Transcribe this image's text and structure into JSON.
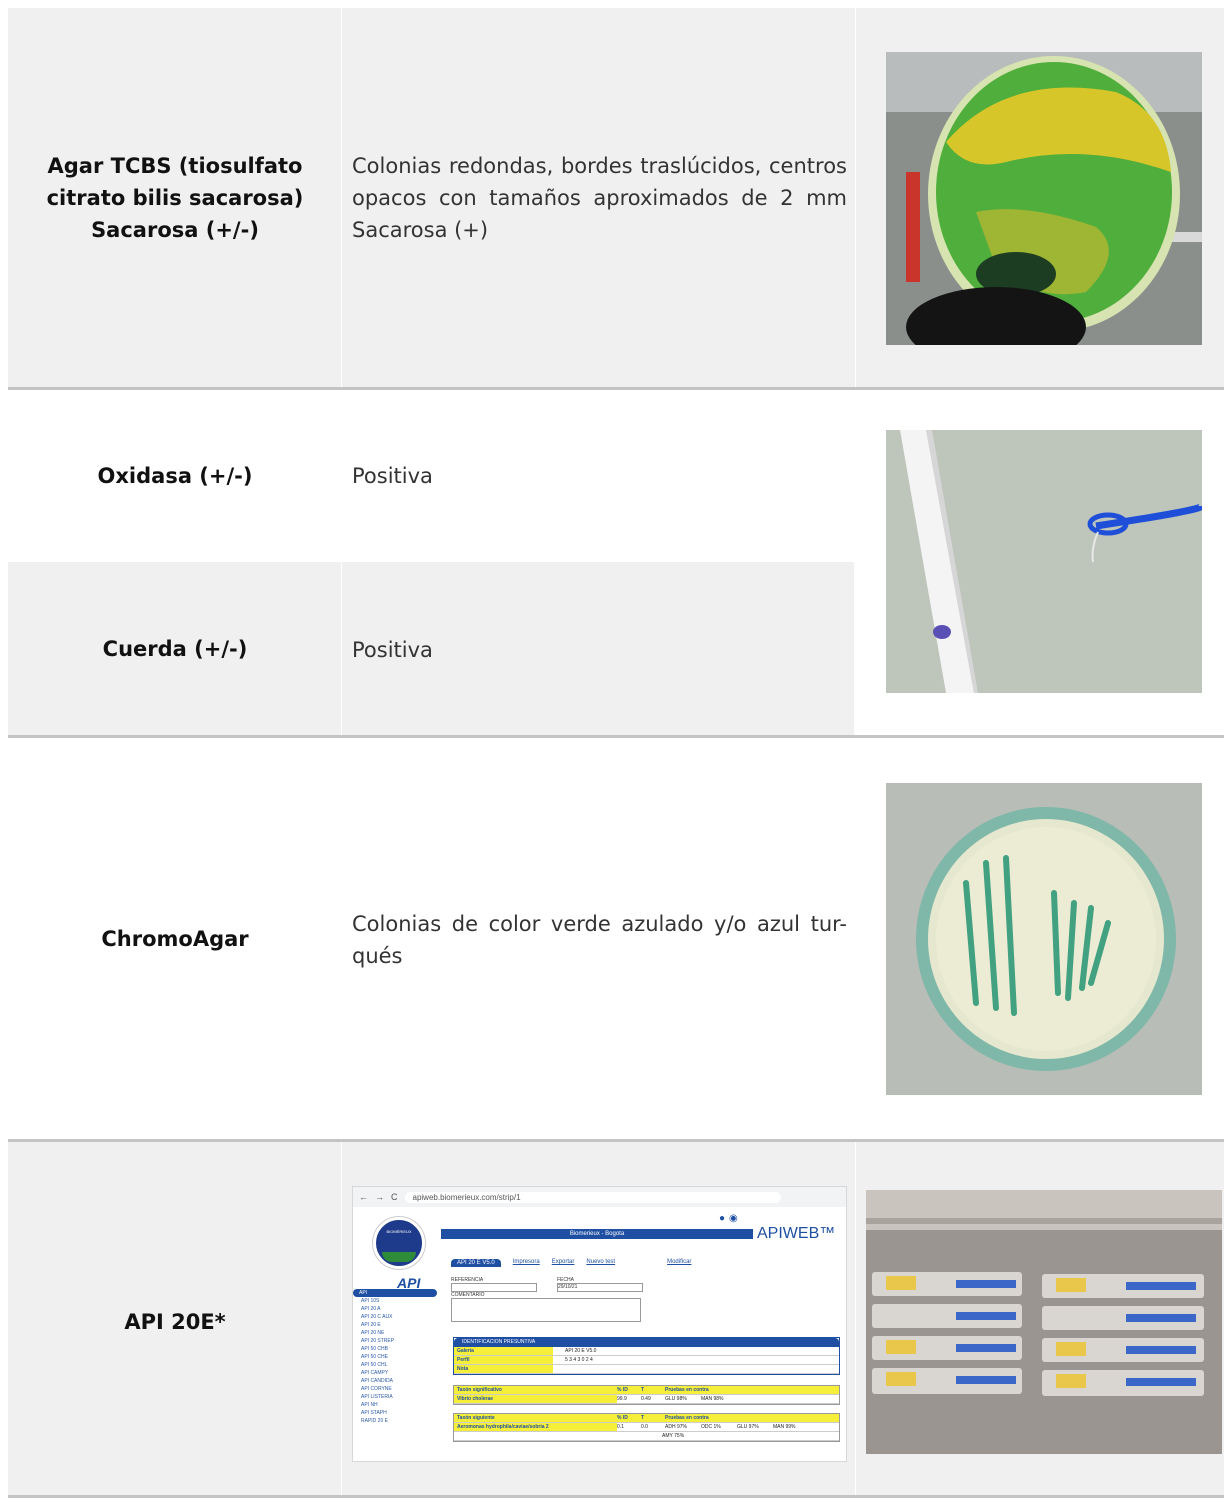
{
  "rows": [
    {
      "label": "Agar TCBS (tiosulfato citrato bilis sacarosa) Sacarosa (+/-)",
      "description": "Colonias redondas, bordes traslúcidos, centros opacos con tamaños aproximados de 2 mm Sacarosa (+)"
    },
    {
      "label": "Oxidasa (+/-)",
      "description": "Positiva"
    },
    {
      "label": "Cuerda (+/-)",
      "description": "Positiva"
    },
    {
      "label": "ChromoAgar",
      "description": "Colonias de color verde azulado y/o azul tur-qués"
    },
    {
      "label": "API 20E*",
      "description": ""
    }
  ],
  "apiweb_screenshot": {
    "url": "apiweb.biomerieux.com/strip/1",
    "logo_text": "BIOMÉRIEUX",
    "header_bar": "Biomerieux - Bogota",
    "brand": "APIWEB™",
    "product": "API",
    "tabs": [
      "API 20 E V5.0",
      "Impresora",
      "Exportar",
      "Nuevo test",
      "Modificar"
    ],
    "fields": {
      "referencia_label": "REFERENCIA",
      "fecha_label": "FECHA",
      "fecha_value": "29/10/21",
      "comentario_label": "COMENTARIO"
    },
    "sidebar_items": [
      "API",
      "API 10S",
      "API 20 A",
      "API 20 C AUX",
      "API 20 E",
      "API 20 NE",
      "API 20 STREP",
      "API 50 CHB",
      "API 50 CHE",
      "API 50 CHL",
      "API CAMPY",
      "API CANDIDA",
      "API CORYNE",
      "API LISTERIA",
      "API NH",
      "API STAPH",
      "RAPID 20 E"
    ],
    "identificacion": {
      "title": "IDENTIFICACION PRESUNTIVA",
      "galeria_label": "Galería",
      "galeria_value": "API 20 E V5.0",
      "perfil_label": "Perfil",
      "perfil_value": "5 3 4 3 0 2 4",
      "nota_label": "Nota"
    },
    "significativo": {
      "headers": [
        "Taxón significativo",
        "% ID",
        "T",
        "Pruebas en contra"
      ],
      "row": [
        "Vibrio cholerae",
        "99.9",
        "0.49",
        "GLU 98%",
        "MAN 98%"
      ]
    },
    "siguiente": {
      "headers": [
        "Taxón siguiente",
        "% ID",
        "T",
        "Pruebas en contra"
      ],
      "row": [
        "Aeromonas hydrophila/caviae/sobria 2",
        "0.1",
        "0.0",
        "ADH 97%",
        "ODC 1%",
        "GLU 97%",
        "MAN 99%"
      ],
      "row2": "AMY 75%"
    }
  }
}
